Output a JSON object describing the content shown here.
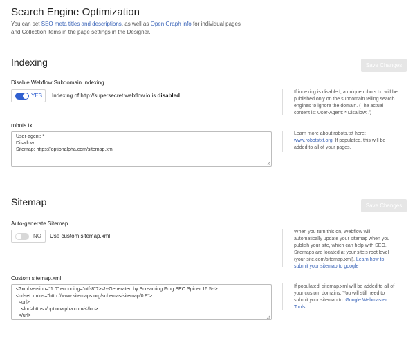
{
  "header": {
    "title": "Search Engine Optimization",
    "desc_before": "You can set ",
    "desc_link1": "SEO meta titles and descriptions",
    "desc_middle": ", as well as ",
    "desc_link2": "Open Graph info",
    "desc_after1": " for individual pages",
    "desc_line2": "and Collection items in the page settings in the Designer."
  },
  "indexing": {
    "title": "Indexing",
    "save_label": "Save Changes",
    "subdomain_label": "Disable Webflow Subdomain Indexing",
    "toggle_state": "YES",
    "toggle_text_before": "Indexing of http://supersecret.webflow.io is ",
    "toggle_text_bold": "disabled",
    "side1_lines": [
      "If indexing is disabled, a unique robots.txt will be",
      "published only on the subdomain telling search",
      "engines to ignore the domain. (The actual",
      "content is: User-Agent: * Disallow: /)"
    ],
    "robots_label": "robots.txt",
    "robots_lines": [
      "User-agent: *",
      "",
      "Disallow:",
      "",
      "Sitemap: https://optionalpha.com/sitemap.xml"
    ],
    "side2_line1": "Learn more about robots.txt here:",
    "side2_link": "www.robotstxt.org",
    "side2_after": ". If populated, this will be",
    "side2_line3": "added to all of your pages."
  },
  "sitemap": {
    "title": "Sitemap",
    "save_label": "Save Changes",
    "auto_label": "Auto-generate Sitemap",
    "toggle_state": "NO",
    "toggle_text": "Use custom sitemap.xml",
    "side1_lines": [
      "When you turn this on, Webflow will",
      "automatically update your sitemap when you",
      "publish your site, which can help with SEO.",
      "Sitemaps are located at your site's root level"
    ],
    "side1_line5_before": "(your-site.com/sitemap.xml). ",
    "side1_link_a": "Learn how to",
    "side1_link_b": "submit your sitemap to google",
    "custom_label": "Custom sitemap.xml",
    "xml_lines": [
      "<?xml version=\"1.0\" encoding=\"utf-8\"?><!--Generated by Screaming Frog SEO Spider 16.5-->",
      "<urlset xmlns=\"http://www.sitemaps.org/schemas/sitemap/0.9\">",
      "  <url>",
      "    <loc>https://optionalpha.com/</loc>",
      "  </url>"
    ],
    "side2_lines": [
      "If populated, sitemap.xml will be added to all of",
      "your custom domains. You will still need to"
    ],
    "side2_line3_before": "submit your sitemap to: ",
    "side2_link_a": "Google Webmaster",
    "side2_link_b": "Tools"
  },
  "colors": {
    "accent": "#3a64b8",
    "toggle_on": "#2f5fd0",
    "toggle_off": "#d8d8d8",
    "button_disabled": "#e6e6e6"
  }
}
